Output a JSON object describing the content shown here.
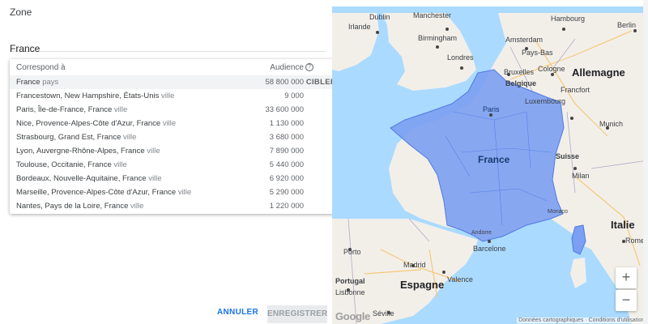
{
  "form": {
    "zone_label": "Zone",
    "location_value": "France",
    "cancel_label": "ANNULER",
    "save_label": "ENREGISTRER"
  },
  "dropdown": {
    "header_match": "Correspond à",
    "header_audience": "Audience",
    "help_icon": "?",
    "target_label": "CIBLER",
    "rows": [
      {
        "name": "France",
        "type": "pays",
        "audience": "58 800 000"
      },
      {
        "name": "Francestown, New Hampshire, États-Unis",
        "type": "ville",
        "audience": "9 000"
      },
      {
        "name": "Paris, Île-de-France, France",
        "type": "ville",
        "audience": "33 600 000"
      },
      {
        "name": "Nice, Provence-Alpes-Côte d'Azur, France",
        "type": "ville",
        "audience": "1 130 000"
      },
      {
        "name": "Strasbourg, Grand Est, France",
        "type": "ville",
        "audience": "3 680 000"
      },
      {
        "name": "Lyon, Auvergne-Rhône-Alpes, France",
        "type": "ville",
        "audience": "7 890 000"
      },
      {
        "name": "Toulouse, Occitanie, France",
        "type": "ville",
        "audience": "5 440 000"
      },
      {
        "name": "Bordeaux, Nouvelle-Aquitaine, France",
        "type": "ville",
        "audience": "6 920 000"
      },
      {
        "name": "Marseille, Provence-Alpes-Côte d'Azur, France",
        "type": "ville",
        "audience": "5 290 000"
      },
      {
        "name": "Nantes, Pays de la Loire, France",
        "type": "ville",
        "audience": "1 220 000"
      }
    ]
  },
  "map": {
    "highlight_color": "#7b9ff2",
    "labels": {
      "irlande": "Irlande",
      "dublin": "Dublin",
      "manchester": "Manchester",
      "birmingham": "Birmingham",
      "londres": "Londres",
      "amsterdam": "Amsterdam",
      "pays_bas": "Pays-Bas",
      "hambourg": "Hambourg",
      "berlin": "Berlin",
      "allemagne": "Allemagne",
      "cologne": "Cologne",
      "bruxelles": "Bruxelles",
      "belgique": "Belgique",
      "luxembourg": "Luxembourg",
      "francfort": "Francfort",
      "paris": "Paris",
      "france": "France",
      "munich": "Munich",
      "suisse": "Suisse",
      "milan": "Milan",
      "monaco": "Monaco",
      "andorre": "Andorre",
      "italie": "Italie",
      "porto": "Porto",
      "barcelone": "Barcelone",
      "madrid": "Madrid",
      "portugal": "Portugal",
      "lisbonne": "Lisbonne",
      "espagne": "Espagne",
      "valence": "Valence",
      "seville": "Séville",
      "rome": "Rome"
    },
    "zoom_in": "+",
    "zoom_out": "−",
    "google": "Google",
    "attribution": "Données cartographiques · Conditions d'utilisation"
  }
}
